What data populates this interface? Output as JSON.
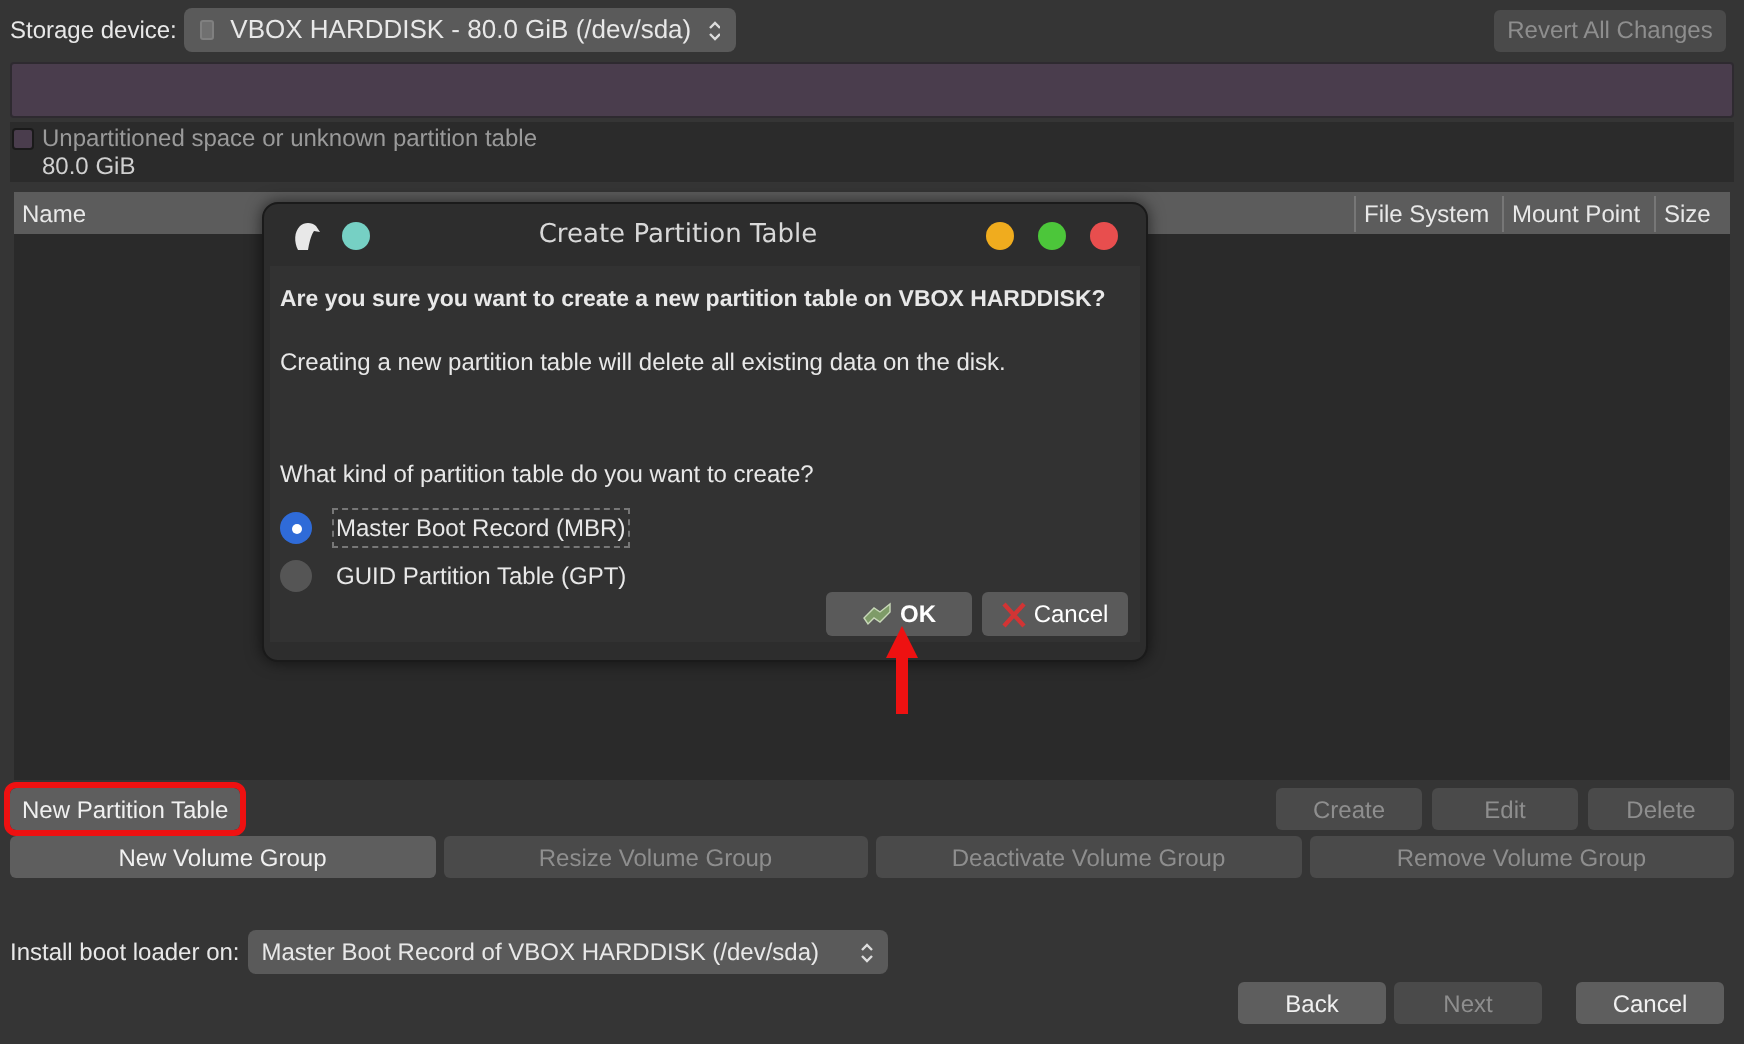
{
  "storage": {
    "label": "Storage device:",
    "value": "VBOX HARDDISK - 80.0 GiB (/dev/sda)"
  },
  "revert_button": {
    "label": "Revert All Changes",
    "disabled": true
  },
  "legend": {
    "label": "Unpartitioned space or unknown partition table",
    "size": "80.0 GiB",
    "checked": false
  },
  "table": {
    "columns": [
      "Name",
      "File System",
      "Mount Point",
      "Size"
    ]
  },
  "partition_buttons": [
    {
      "label": "New Partition Table",
      "disabled": false,
      "highlighted": true
    },
    {
      "label": "Create",
      "disabled": true,
      "highlighted": false
    },
    {
      "label": "Edit",
      "disabled": true,
      "highlighted": false
    },
    {
      "label": "Delete",
      "disabled": true,
      "highlighted": false
    }
  ],
  "volume_buttons": [
    {
      "label": "New Volume Group",
      "disabled": false
    },
    {
      "label": "Resize Volume Group",
      "disabled": true
    },
    {
      "label": "Deactivate Volume Group",
      "disabled": true
    },
    {
      "label": "Remove Volume Group",
      "disabled": true
    }
  ],
  "boot_loader": {
    "label": "Install boot loader on:",
    "value": "Master Boot Record of VBOX HARDDISK (/dev/sda)"
  },
  "nav_buttons": [
    {
      "label": "Back",
      "disabled": false
    },
    {
      "label": "Next",
      "disabled": true
    },
    {
      "label": "Cancel",
      "disabled": false
    }
  ],
  "dialog": {
    "title": "Create Partition Table",
    "question": "Are you sure you want to create a new partition table on VBOX HARDDISK?",
    "warning": "Creating a new partition table will delete all existing data on the disk.",
    "prompt": "What kind of partition table do you want to create?",
    "options": [
      {
        "label": "Master Boot Record (MBR)",
        "selected": true
      },
      {
        "label": "GUID Partition Table (GPT)",
        "selected": false
      }
    ],
    "buttons": [
      {
        "kind": "ok",
        "label": "OK"
      },
      {
        "kind": "cancel",
        "label": "Cancel"
      }
    ]
  },
  "annotations": [
    {
      "kind": "arrow"
    }
  ]
}
